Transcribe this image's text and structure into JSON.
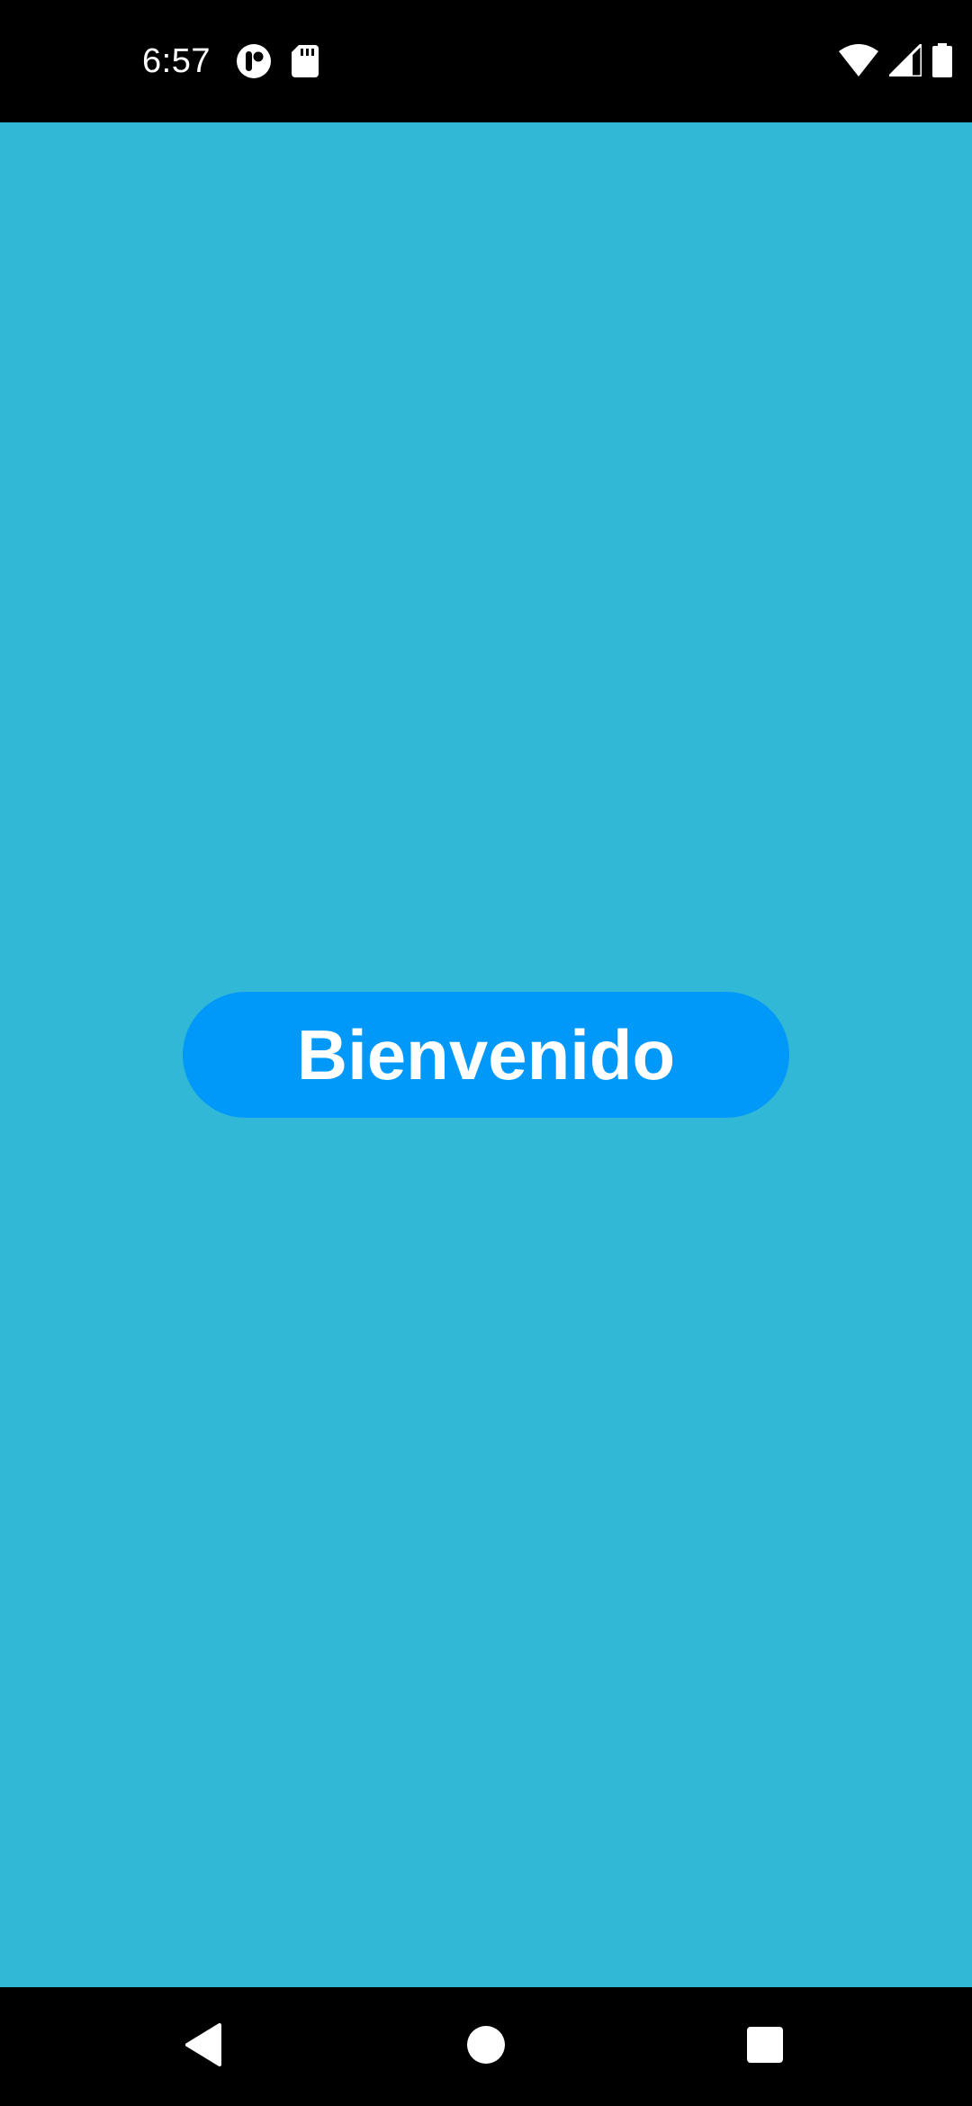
{
  "status_bar": {
    "time": "6:57",
    "left_icons": [
      "app-notification-icon",
      "sd-card-icon"
    ],
    "right_icons": [
      "wifi-icon",
      "cellular-signal-icon",
      "battery-icon"
    ]
  },
  "main": {
    "welcome_button_label": "Bienvenido",
    "background_color": "#30b8d6",
    "button_color": "#0098f9"
  },
  "nav_bar": {
    "buttons": [
      "back",
      "home",
      "recents"
    ]
  }
}
